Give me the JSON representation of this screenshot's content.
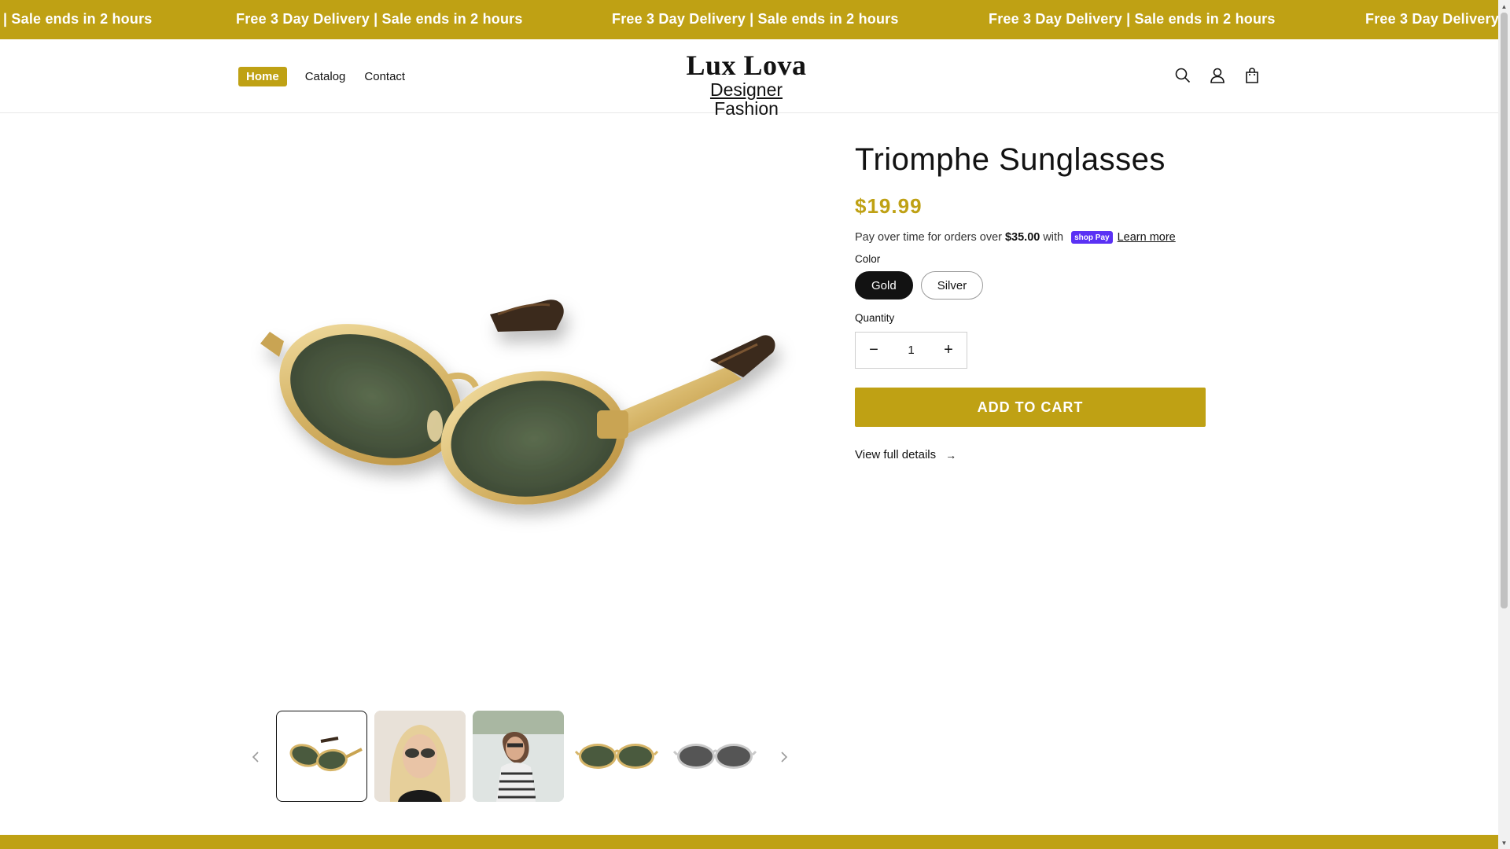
{
  "announcement": {
    "items": [
      "| Sale ends in 2 hours",
      "Free 3 Day Delivery | Sale ends in 2 hours",
      "Free 3 Day Delivery | Sale ends in 2 hours",
      "Free 3 Day Delivery | Sale ends in 2 hours",
      "Free 3 Day Delivery"
    ]
  },
  "header": {
    "nav": [
      {
        "label": "Home",
        "active": true
      },
      {
        "label": "Catalog"
      },
      {
        "label": "Contact"
      }
    ],
    "logo": {
      "line1": "Lux Lova",
      "line2_underlined": "Designer",
      "line2_rest": " Fashion"
    },
    "icons": [
      "search-icon",
      "account-icon",
      "cart-icon"
    ]
  },
  "product": {
    "title": "Triomphe Sunglasses",
    "price": "$19.99",
    "installments": {
      "prefix": "Pay over time for orders over",
      "amount": "$35.00",
      "suffix": "with",
      "badge": "shop Pay",
      "link": "Learn more"
    },
    "color": {
      "label": "Color",
      "options": [
        "Gold",
        "Silver"
      ],
      "selected": "Gold"
    },
    "quantity": {
      "label": "Quantity",
      "value": "1",
      "minus": "−",
      "plus": "+"
    },
    "add_to_cart": "ADD TO CART",
    "view_details": "View full details",
    "view_details_arrow": "→"
  },
  "gallery": {
    "thumbnail_count": 5,
    "selected_index": 0
  },
  "colors": {
    "accent": "#bfa114",
    "text": "#121212",
    "white": "#ffffff",
    "shop_pay": "#5a31f4"
  }
}
